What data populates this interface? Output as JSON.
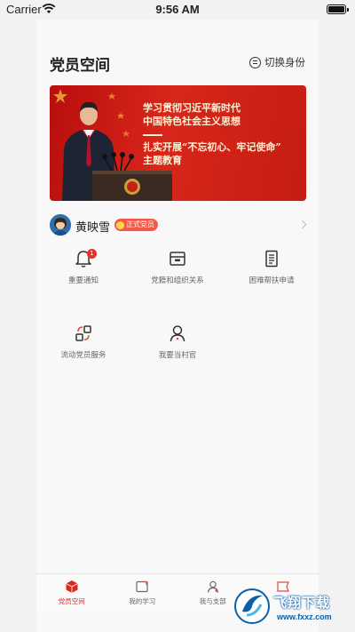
{
  "status_bar": {
    "carrier": "Carrier",
    "time": "9:56 AM"
  },
  "header": {
    "title": "党员空间",
    "switch_identity_label": "切换身份"
  },
  "banner": {
    "line1": "学习贯彻习近平新时代",
    "line2": "中国特色社会主义思想",
    "line3": "扎实开展“不忘初心、牢记使命”",
    "line4": "主题教育"
  },
  "user": {
    "name": "黄映雪",
    "badge": "正式党员"
  },
  "grid": {
    "items": [
      {
        "label": "重要通知",
        "icon": "bell-icon",
        "badge": "1"
      },
      {
        "label": "党籍和组织关系",
        "icon": "archive-box-icon"
      },
      {
        "label": "困难帮扶申请",
        "icon": "document-icon"
      },
      {
        "label": "流动党员服务",
        "icon": "transfer-icon"
      },
      {
        "label": "我要当村官",
        "icon": "person-pin-icon"
      }
    ]
  },
  "tabbar": {
    "tabs": [
      {
        "label": "党员空间",
        "icon": "cube-icon",
        "active": true
      },
      {
        "label": "我的学习",
        "icon": "study-icon",
        "active": false
      },
      {
        "label": "我与支部",
        "icon": "member-icon",
        "active": false
      },
      {
        "label": "",
        "icon": "flag-icon",
        "active": false
      }
    ]
  },
  "watermark": {
    "brand": "飞翔下载",
    "domain": "www.fxxz.com"
  },
  "colors": {
    "accent": "#d82a20",
    "banner_red": "#c51c12",
    "badge_red": "#f4584a",
    "watermark_blue": "#0a5fa8"
  }
}
